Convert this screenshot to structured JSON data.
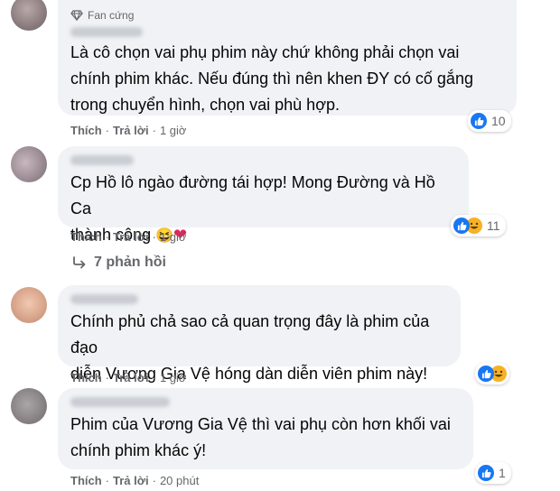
{
  "comments": [
    {
      "badge": "Fan cứng",
      "text": "Là cô chọn vai phụ phim này chứ không phải chọn vai\nchính phim khác. Nếu đúng thì nên khen ĐY có cố gắng\ntrong chuyển hình, chọn vai phù hợp.",
      "like_label": "Thích",
      "reply_label": "Trả lời",
      "time": "1 giờ",
      "reactions": [
        "like-icon"
      ],
      "reaction_count": "10"
    },
    {
      "text": "Cp Hồ lô ngào đường tái hợp! Mong Đường và Hồ Ca\nthành công",
      "emojis": [
        "😆",
        "❤"
      ],
      "like_label": "Thích",
      "reply_label": "Trả lời",
      "time": "1 giờ",
      "reactions": [
        "like-icon",
        "haha-icon"
      ],
      "reaction_count": "11",
      "replies_label": "7 phản hồi"
    },
    {
      "text": "Chính phủ chả sao cả quan trọng đây là phim của đạo\ndiễn Vương Gia Vệ hóng dàn diễn viên phim này!",
      "like_label": "Thích",
      "reply_label": "Trả lời",
      "time": "1 giờ",
      "reactions": [
        "like-icon",
        "haha-icon"
      ],
      "reaction_count": ""
    },
    {
      "text": "Phim của Vương Gia Vệ thì vai phụ còn hơn khối vai\nchính phim khác ý!",
      "like_label": "Thích",
      "reply_label": "Trả lời",
      "time": "20 phút",
      "reactions": [
        "like-icon"
      ],
      "reaction_count": "1"
    }
  ],
  "colors": {
    "bubble": "#f0f2f5",
    "like": "#1877f2",
    "haha": "#f7b125",
    "meta": "#65676b"
  }
}
